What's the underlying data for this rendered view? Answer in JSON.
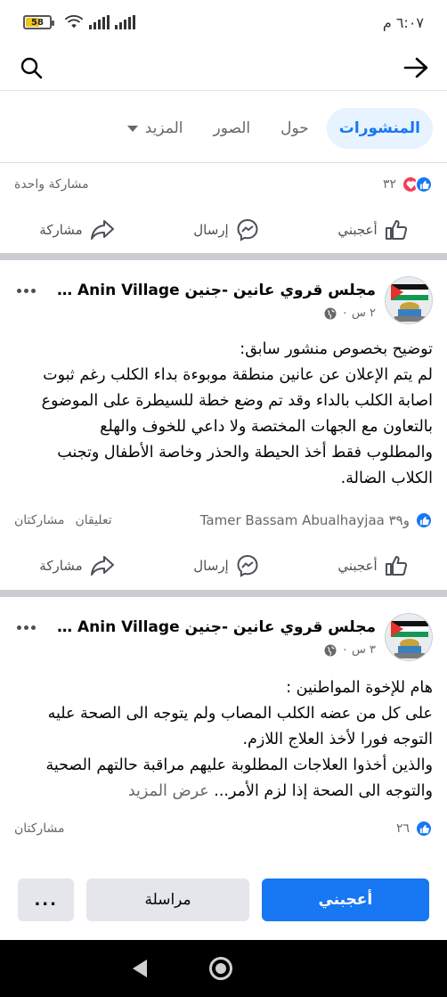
{
  "status_bar": {
    "battery": "58",
    "battery_level_percent": 58,
    "time": "٦:٠٧ م"
  },
  "toolbar": {
    "back_icon": "arrow-right-icon",
    "search_icon": "search-icon"
  },
  "tabs": {
    "posts": "المنشورات",
    "about": "حول",
    "photos": "الصور",
    "more": "المزيد"
  },
  "prev_post": {
    "reaction_count": "٣٢",
    "shares": "مشاركة واحدة",
    "actions": {
      "like": "أعجبني",
      "send": "إرسال",
      "share": "مشاركة"
    }
  },
  "post1": {
    "page_name": "مجلس قروي عانين -جنين  Anin Village …",
    "time": "٢ س ٠",
    "text_lines": [
      "توضيح بخصوص منشور سابق:",
      "لم يتم الإعلان عن عانين منطقة موبوءة بداء الكلب رغم ثبوت",
      "اصابة الكلب بالداء وقد تم وضع خطة للسيطرة على الموضوع",
      "بالتعاون مع الجهات المختصة ولا داعي للخوف والهلع",
      "والمطلوب فقط أخذ الحيطة والحذر وخاصة الأطفال وتجنب",
      "الكلاب الضالة."
    ],
    "reactions": "Tamer Bassam Abualhayjaa و٣٩",
    "comments": "تعليقان",
    "shares": "مشاركتان",
    "actions": {
      "like": "أعجبني",
      "send": "إرسال",
      "share": "مشاركة"
    }
  },
  "post2": {
    "page_name": "مجلس قروي عانين -جنين  Anin Village …",
    "time": "٣ س ٠",
    "text_lines": [
      "هام للإخوة المواطنين :",
      "على كل من عضه الكلب المصاب ولم يتوجه الى الصحة عليه",
      "التوجه فورا لأخذ العلاج اللازم.",
      "والذين أخذوا العلاجات المطلوبة عليهم مراقبة حالتهم الصحية",
      "والتوجه الى الصحة إذا لزم الأمر..."
    ],
    "see_more": "عرض المزيد",
    "reaction_count": "٢٦",
    "shares": "مشاركتان"
  },
  "bottom_bar": {
    "like": "أعجبني",
    "message": "مراسلة",
    "more": "..."
  },
  "colors": {
    "accent": "#1877f2",
    "love": "#f33e58",
    "tab_active_bg": "#e7f3ff"
  }
}
